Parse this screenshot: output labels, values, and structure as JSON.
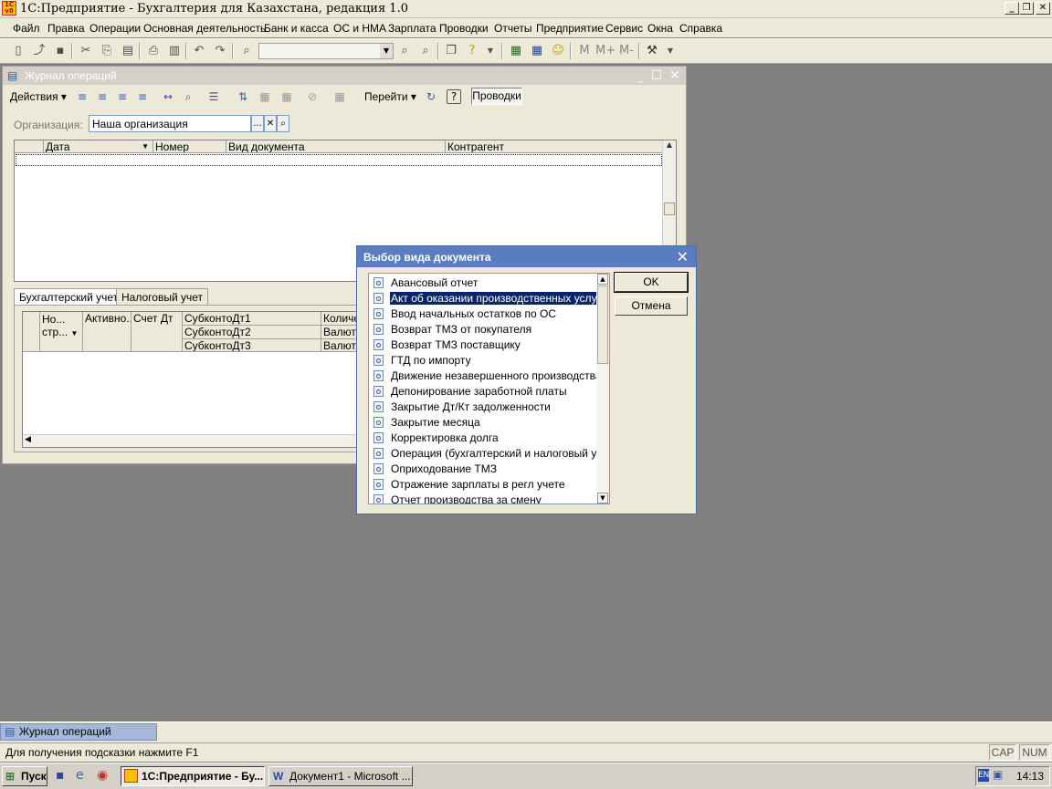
{
  "app": {
    "title": "1С:Предприятие - Бухгалтерия для Казахстана, редакция 1.0",
    "logo_text": "1C v8"
  },
  "menu": [
    "Файл",
    "Правка",
    "Операции",
    "Основная деятельность",
    "Банк и касса",
    "ОС и НМА",
    "Зарплата",
    "Проводки",
    "Отчеты",
    "Предприятие",
    "Сервис",
    "Окна",
    "Справка"
  ],
  "toolbar": {
    "search_value": "",
    "mem_buttons": [
      "M",
      "M+",
      "M-"
    ]
  },
  "journal": {
    "title": "Журнал операций",
    "actions_label": "Действия",
    "goto_label": "Перейти",
    "provodki_label": "Проводки",
    "help_label": "?",
    "org_label": "Организация:",
    "org_value": "Наша организация",
    "org_select_btn": "...",
    "org_clear_btn": "✕",
    "columns": [
      "Дата",
      "Номер",
      "Вид документа",
      "Контрагент"
    ],
    "tabs": [
      "Бухгалтерский учет",
      "Налоговый учет"
    ],
    "lower_columns": {
      "no_str": "Но... стр...",
      "active": "Активно...",
      "schet_dt": "Счет Дт",
      "subkonto": [
        "СубконтоДт1",
        "СубконтоДт2",
        "СубконтоДт3"
      ],
      "right": [
        "Количес",
        "Валюта",
        "Валютн"
      ]
    }
  },
  "dialog": {
    "title": "Выбор вида документа",
    "ok_label": "OK",
    "cancel_label": "Отмена",
    "selected_index": 1,
    "items": [
      "Авансовый отчет",
      "Акт об оказании производственных услуг",
      "Ввод начальных остатков по ОС",
      "Возврат ТМЗ от покупателя",
      "Возврат ТМЗ поставщику",
      "ГТД по импорту",
      "Движение незавершенного производства",
      "Депонирование заработной платы",
      "Закрытие Дт/Кт задолженности",
      "Закрытие месяца",
      "Корректировка долга",
      "Операция (бухгалтерский и налоговый учет)",
      "Оприходование ТМЗ",
      "Отражение зарплаты в регл учете",
      "Отчет производства за смену"
    ]
  },
  "mdi_tasks": [
    "Журнал операций"
  ],
  "status": {
    "hint": "Для получения подсказки нажмите F1",
    "cap": "CAP",
    "num": "NUM"
  },
  "taskbar": {
    "start": "Пуск",
    "buttons": [
      "1С:Предприятие - Бу...",
      "Документ1 - Microsoft ..."
    ],
    "lang": "EN",
    "clock": "14:13"
  }
}
